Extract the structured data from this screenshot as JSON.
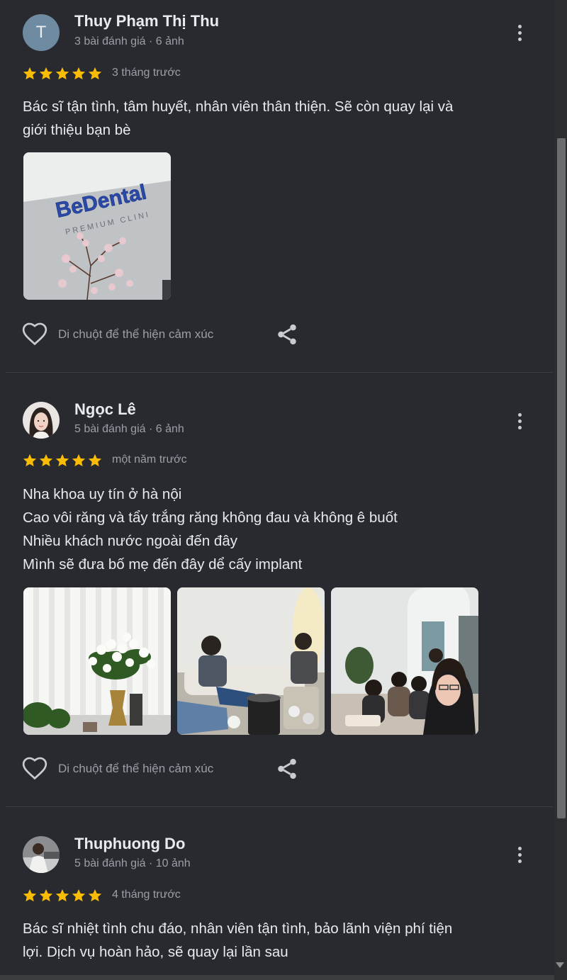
{
  "reviews": [
    {
      "avatar_letter": "T",
      "name": "Thuy Phạm Thị Thu",
      "meta": "3 bài đánh giá · 6 ảnh",
      "rating": 5,
      "time": "3 tháng trước",
      "text_lines": [
        "Bác sĩ tận tình, tâm huyết, nhân viên thân thiện. Sẽ còn quay lại và",
        "giới thiệu bạn bè"
      ],
      "photo_sign_text": [
        "BeDental",
        "PREMIUM CLINI"
      ],
      "like_hint": "Di chuột để thể hiện cảm xúc"
    },
    {
      "name": "Ngọc Lê",
      "meta": "5 bài đánh giá · 6 ảnh",
      "rating": 5,
      "time": "một năm trước",
      "text_lines": [
        "Nha khoa uy tín ở hà nội",
        "Cao vôi răng và tẩy trắng răng không đau và không ê buốt",
        "Nhiều khách nước ngoài đến đây",
        "Mình sẽ đưa bố mẹ đến đây dể cấy implant"
      ],
      "like_hint": "Di chuột để thể hiện cảm xúc"
    },
    {
      "name": "Thuphuong Do",
      "meta": "5 bài đánh giá · 10 ảnh",
      "rating": 5,
      "time": "4 tháng trước",
      "text_lines": [
        "Bác sĩ nhiệt tình chu đáo, nhân viên tận tình, bảo lãnh viện phí tiện",
        "lợi. Dịch vụ hoàn hảo, sẽ quay lại lần sau"
      ]
    }
  ],
  "colors": {
    "background": "#282a30",
    "star": "#fbbc04",
    "text": "#e8eaed",
    "secondary_text": "#9aa0a6"
  },
  "icons": [
    "more-vert-icon",
    "star-icon",
    "heart-outline-icon",
    "share-icon"
  ]
}
